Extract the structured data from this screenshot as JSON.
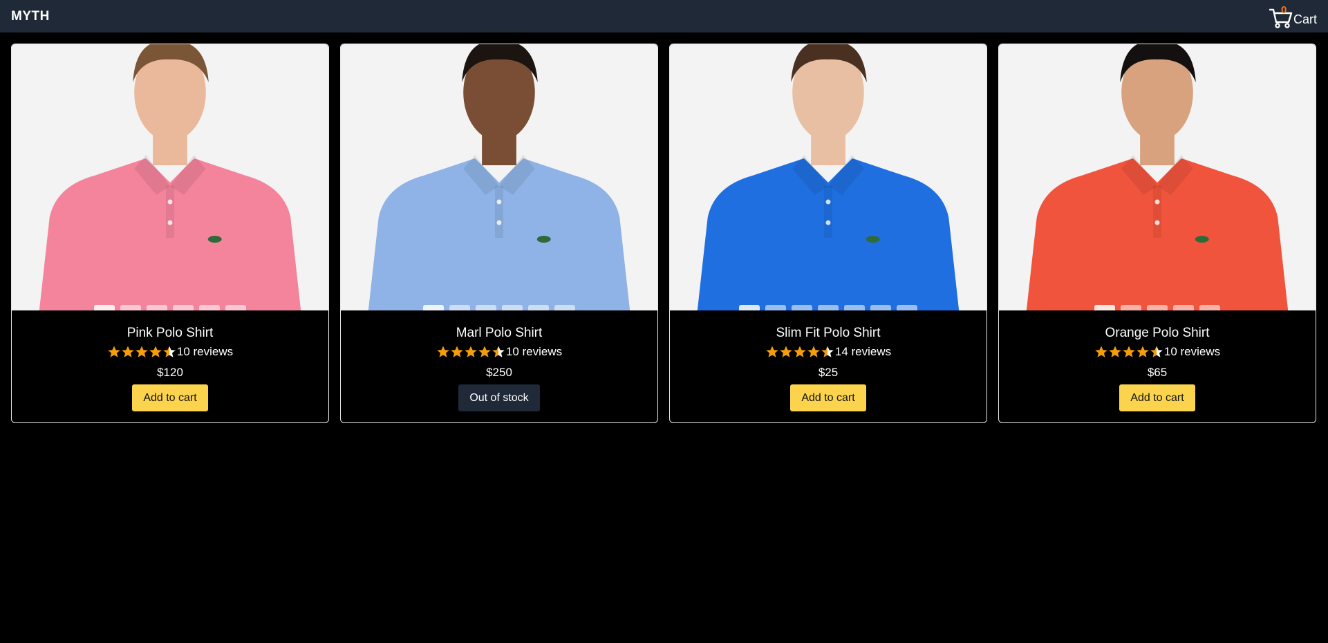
{
  "header": {
    "brand": "MYTH",
    "cart_count": "0",
    "cart_label": "Cart"
  },
  "colors": {
    "header_bg": "#1f2937",
    "accent_yellow": "#fcd34d",
    "star": "#f59e0b",
    "cart_count": "#f97316"
  },
  "products": [
    {
      "name": "Pink Polo Shirt",
      "rating": 4.5,
      "reviews": "10 reviews",
      "price": "$120",
      "button": "Add to cart",
      "in_stock": true,
      "shirt_color": "#f4849c",
      "thumbs": 6
    },
    {
      "name": "Marl Polo Shirt",
      "rating": 4.5,
      "reviews": "10 reviews",
      "price": "$250",
      "button": "Out of stock",
      "in_stock": false,
      "shirt_color": "#8fb3e6",
      "thumbs": 6
    },
    {
      "name": "Slim Fit Polo Shirt",
      "rating": 4.5,
      "reviews": "14 reviews",
      "price": "$25",
      "button": "Add to cart",
      "in_stock": true,
      "shirt_color": "#1f6fe0",
      "thumbs": 7
    },
    {
      "name": "Orange Polo Shirt",
      "rating": 4.5,
      "reviews": "10 reviews",
      "price": "$65",
      "button": "Add to cart",
      "in_stock": true,
      "shirt_color": "#f0543c",
      "thumbs": 5
    }
  ]
}
